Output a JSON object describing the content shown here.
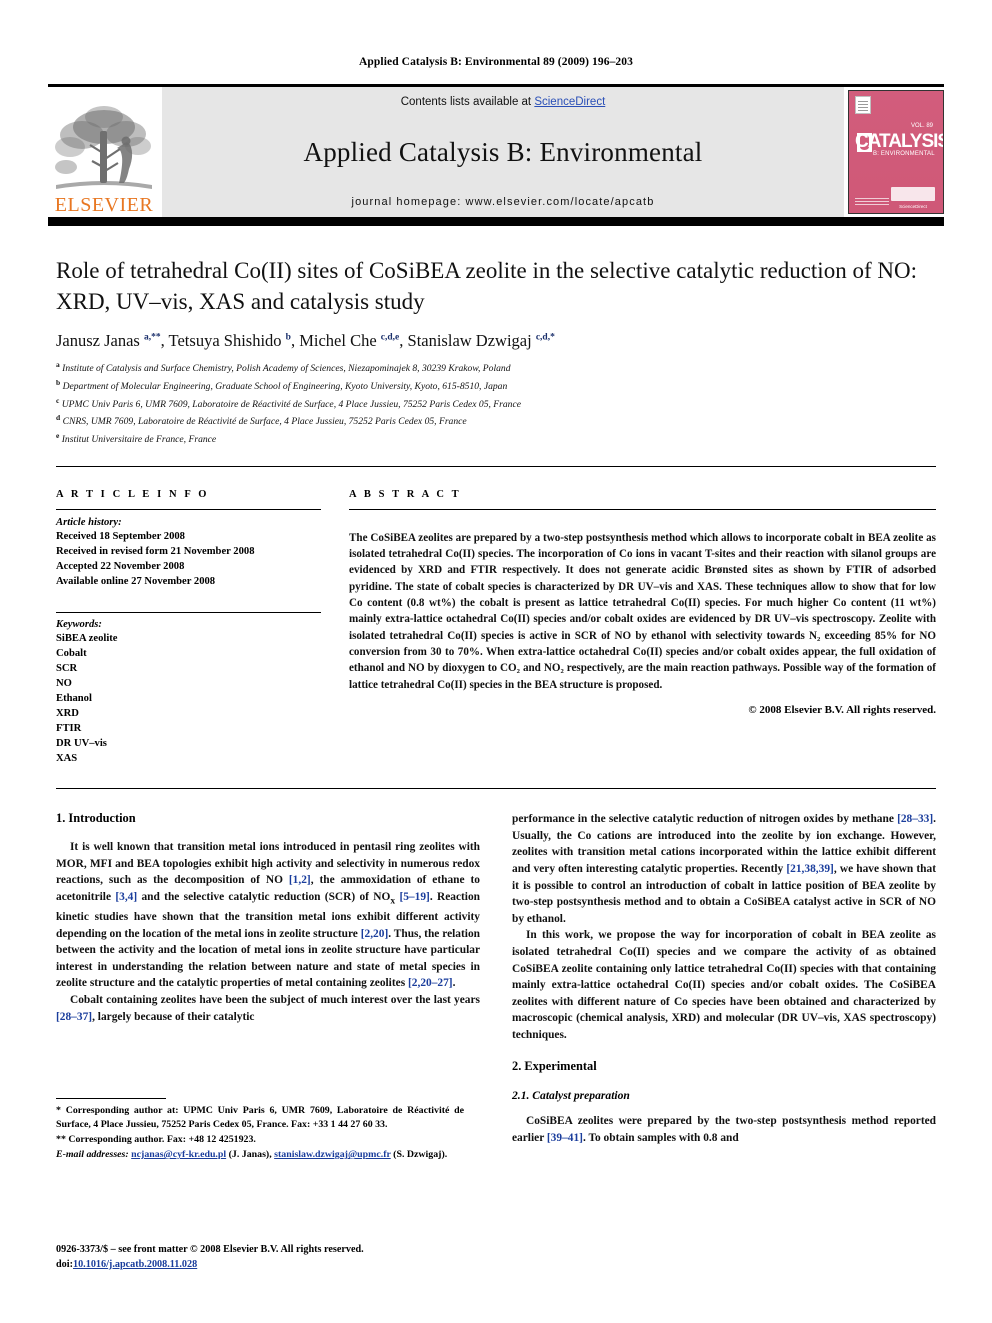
{
  "running_head": "Applied Catalysis B: Environmental 89 (2009) 196–203",
  "masthead": {
    "contents_prefix": "Contents lists available at ",
    "sciencedirect": "ScienceDirect",
    "journal_title": "Applied Catalysis B: Environmental",
    "homepage": "journal homepage: www.elsevier.com/locate/apcatb",
    "publisher": "ELSEVIER",
    "cover_title": "CATALYSIS",
    "cover_sub": "B: ENVIRONMENTAL",
    "cover_vol": "VOL. 89",
    "cover_sd": "ScienceDirect",
    "accent_orange": "#E87722",
    "accent_link": "#2a4fb7",
    "cover_pink": "#d25d7c",
    "band_gray": "#e6e6e6"
  },
  "article": {
    "title": "Role of tetrahedral Co(II) sites of CoSiBEA zeolite in the selective catalytic reduction of NO: XRD, UV–vis, XAS and catalysis study",
    "authors_html": "Janusz Janas <sup>a,**</sup>, Tetsuya Shishido <sup>b</sup>, Michel Che <sup>c,d,e</sup>, Stanislaw Dzwigaj <sup>c,d,*</sup>",
    "affiliations": [
      {
        "mark": "a",
        "text": "Institute of Catalysis and Surface Chemistry, Polish Academy of Sciences, Niezapominajek 8, 30239 Krakow, Poland"
      },
      {
        "mark": "b",
        "text": "Department of Molecular Engineering, Graduate School of Engineering, Kyoto University, Kyoto, 615-8510, Japan"
      },
      {
        "mark": "c",
        "text": "UPMC Univ Paris 6, UMR 7609, Laboratoire de Réactivité de Surface, 4 Place Jussieu, 75252 Paris Cedex 05, France"
      },
      {
        "mark": "d",
        "text": "CNRS, UMR 7609, Laboratoire de Réactivité de Surface, 4 Place Jussieu, 75252 Paris Cedex 05, France"
      },
      {
        "mark": "e",
        "text": "Institut Universitaire de France, France"
      }
    ]
  },
  "info": {
    "heading": "A R T I C L E   I N F O",
    "history_title": "Article history:",
    "history": [
      "Received 18 September 2008",
      "Received in revised form 21 November 2008",
      "Accepted 22 November 2008",
      "Available online 27 November 2008"
    ],
    "keywords_title": "Keywords:",
    "keywords": [
      "SiBEA zeolite",
      "Cobalt",
      "SCR",
      "NO",
      "Ethanol",
      "XRD",
      "FTIR",
      "DR UV–vis",
      "XAS"
    ]
  },
  "abstract": {
    "heading": "A B S T R A C T",
    "text": "The CoSiBEA zeolites are prepared by a two-step postsynthesis method which allows to incorporate cobalt in BEA zeolite as isolated tetrahedral Co(II) species. The incorporation of Co ions in vacant T-sites and their reaction with silanol groups are evidenced by XRD and FTIR respectively. It does not generate acidic Brønsted sites as shown by FTIR of adsorbed pyridine. The state of cobalt species is characterized by DR UV–vis and XAS. These techniques allow to show that for low Co content (0.8 wt%) the cobalt is present as lattice tetrahedral Co(II) species. For much higher Co content (11 wt%) mainly extra-lattice octahedral Co(II) species and/or cobalt oxides are evidenced by DR UV–vis spectroscopy. Zeolite with isolated tetrahedral Co(II) species is active in SCR of NO by ethanol with selectivity towards N₂ exceeding 85% for NO conversion from 30 to 70%. When extra-lattice octahedral Co(II) species and/or cobalt oxides appear, the full oxidation of ethanol and NO by dioxygen to CO₂ and NO₂ respectively, are the main reaction pathways. Possible way of the formation of lattice tetrahedral Co(II) species in the BEA structure is proposed.",
    "copyright": "© 2008 Elsevier B.V. All rights reserved."
  },
  "body": {
    "intro_heading": "1. Introduction",
    "intro_p1_parts": [
      "It is well known that transition metal ions introduced in pentasil ring zeolites with MOR, MFI and BEA topologies exhibit high activity and selectivity in numerous redox reactions, such as the decomposition of NO ",
      "[1,2]",
      ", the ammoxidation of ethane to acetonitrile ",
      "[3,4]",
      " and the selective catalytic reduction (SCR) of NO",
      "x",
      " ",
      "[5–19]",
      ". Reaction kinetic studies have shown that the transition metal ions exhibit different activity depending on the location of the metal ions in zeolite structure ",
      "[2,20]",
      ". Thus, the relation between the activity and the location of metal ions in zeolite structure have particular interest in understanding the relation between nature and state of metal species in zeolite structure and the catalytic properties of metal containing zeolites ",
      "[2,20–27]",
      "."
    ],
    "intro_p2_a": "Cobalt containing zeolites have been the subject of much interest over the last years ",
    "intro_p2_ref": "[28–37]",
    "intro_p2_b": ", largely because of their catalytic",
    "intro_p3_a": "performance in the selective catalytic reduction of nitrogen oxides by methane ",
    "intro_p3_ref1": "[28–33]",
    "intro_p3_b": ". Usually, the Co cations are introduced into the zeolite by ion exchange. However, zeolites with transition metal cations incorporated within the lattice exhibit different and very often interesting catalytic properties. Recently ",
    "intro_p3_ref2": "[21,38,39]",
    "intro_p3_c": ", we have shown that it is possible to control an introduction of cobalt in lattice position of BEA zeolite by two-step postsynthesis method and to obtain a CoSiBEA catalyst active in SCR of NO by ethanol.",
    "intro_p4": "In this work, we propose the way for incorporation of cobalt in BEA zeolite as isolated tetrahedral Co(II) species and we compare the activity of as obtained CoSiBEA zeolite containing only lattice tetrahedral Co(II) species with that containing mainly extra-lattice octahedral Co(II) species and/or cobalt oxides. The CoSiBEA zeolites with different nature of Co species have been obtained and characterized by macroscopic (chemical analysis, XRD) and molecular (DR UV–vis, XAS spectroscopy) techniques.",
    "exp_heading": "2. Experimental",
    "exp_sub_heading": "2.1. Catalyst preparation",
    "exp_p1_a": "CoSiBEA zeolites were prepared by the two-step postsynthesis method reported earlier ",
    "exp_p1_ref": "[39–41]",
    "exp_p1_b": ". To obtain samples with 0.8 and"
  },
  "footnotes": {
    "fn1": "* Corresponding author at: UPMC Univ Paris 6, UMR 7609, Laboratoire de Réactivité de Surface, 4 Place Jussieu, 75252 Paris Cedex 05, France. Fax: +33 1 44 27 60 33.",
    "fn2": "** Corresponding author. Fax: +48 12 4251923.",
    "fn3_label": "E-mail addresses:",
    "fn3_email1": "ncjanas@cyf-kr.edu.pl",
    "fn3_mid": " (J. Janas), ",
    "fn3_email2": "stanislaw.dzwigaj@upmc.fr",
    "fn3_end": " (S. Dzwigaj)."
  },
  "issn": {
    "line1": "0926-3373/$ – see front matter © 2008 Elsevier B.V. All rights reserved.",
    "doi_label": "doi:",
    "doi_value": "10.1016/j.apcatb.2008.11.028"
  }
}
